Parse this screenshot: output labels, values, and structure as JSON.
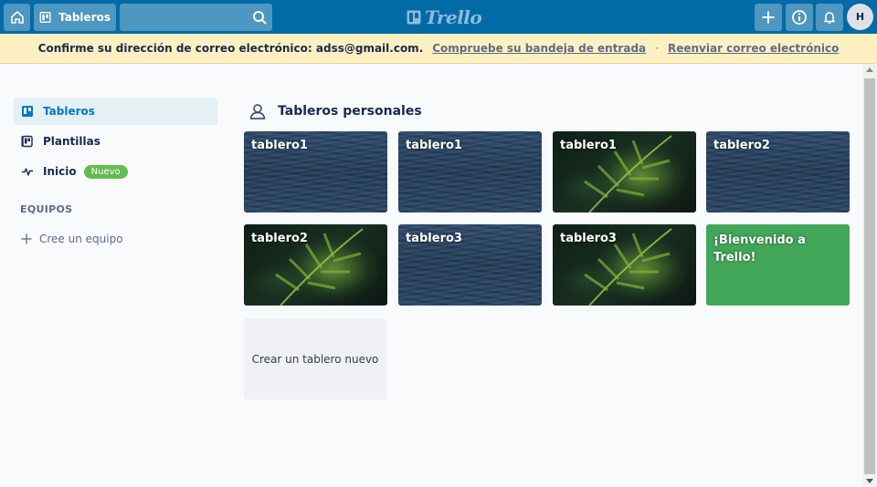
{
  "header": {
    "boards_label": "Tableros",
    "search_value": "",
    "logo_text": "Trello",
    "avatar_initial": "H"
  },
  "banner": {
    "message": "Confirme su dirección de correo electrónico: adss@gmail.com.",
    "check_inbox_link": "Compruebe su bandeja de entrada",
    "separator": "·",
    "resend_link": "Reenviar correo electrónico"
  },
  "sidebar": {
    "items": [
      {
        "label": "Tableros",
        "icon": "board-icon",
        "active": true
      },
      {
        "label": "Plantillas",
        "icon": "template-icon",
        "active": false
      },
      {
        "label": "Inicio",
        "icon": "activity-icon",
        "active": false,
        "badge": "Nuevo"
      }
    ],
    "teams_title": "EQUIPOS",
    "create_team_label": "Cree un equipo"
  },
  "main": {
    "section_title": "Tableros personales",
    "boards": [
      {
        "title": "tablero1",
        "background": "water"
      },
      {
        "title": "tablero1",
        "background": "water"
      },
      {
        "title": "tablero1",
        "background": "jungle"
      },
      {
        "title": "tablero2",
        "background": "water"
      },
      {
        "title": "tablero2",
        "background": "jungle"
      },
      {
        "title": "tablero3",
        "background": "water"
      },
      {
        "title": "tablero3",
        "background": "jungle"
      },
      {
        "title": "¡Bienvenido a Trello!",
        "background": "green"
      }
    ],
    "create_board_label": "Crear un tablero nuevo"
  },
  "colors": {
    "header": "#026aa7",
    "banner": "#fdf1c3",
    "welcome_board": "#43a75a",
    "badge": "#61bd4f",
    "active_nav": "#0079bf"
  }
}
